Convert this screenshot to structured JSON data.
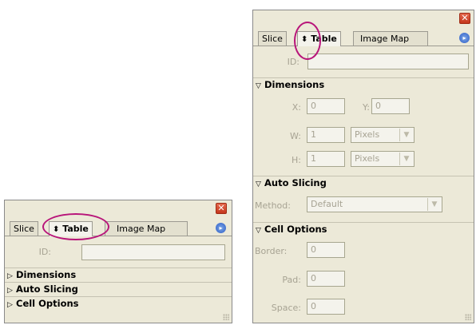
{
  "colors": {
    "panel_bg": "#ece9d8",
    "highlight": "#b8157a",
    "close_red": "#d04a2c",
    "menu_blue": "#3c6bd0"
  },
  "small_panel": {
    "close_icon": "✕",
    "tabs": [
      {
        "label": "Slice"
      },
      {
        "label": "Table",
        "active": true
      },
      {
        "label": "Image Map"
      }
    ],
    "menu_icon": "▸",
    "id_label": "ID:",
    "id_value": "",
    "sections": [
      {
        "label": "Dimensions",
        "state": "collapsed"
      },
      {
        "label": "Auto Slicing",
        "state": "collapsed"
      },
      {
        "label": "Cell Options",
        "state": "collapsed"
      }
    ]
  },
  "large_panel": {
    "close_icon": "✕",
    "tabs": [
      {
        "label": "Slice"
      },
      {
        "label": "Table",
        "active": true
      },
      {
        "label": "Image Map"
      }
    ],
    "menu_icon": "▸",
    "id_label": "ID:",
    "id_value": "",
    "dimensions": {
      "title": "Dimensions",
      "x_label": "X:",
      "x_value": "0",
      "y_label": "Y:",
      "y_value": "0",
      "w_label": "W:",
      "w_value": "1",
      "w_unit": "Pixels",
      "h_label": "H:",
      "h_value": "1",
      "h_unit": "Pixels"
    },
    "auto_slicing": {
      "title": "Auto Slicing",
      "method_label": "Method:",
      "method_value": "Default"
    },
    "cell_options": {
      "title": "Cell Options",
      "border_label": "Border:",
      "border_value": "0",
      "pad_label": "Pad:",
      "pad_value": "0",
      "space_label": "Space:",
      "space_value": "0"
    }
  }
}
